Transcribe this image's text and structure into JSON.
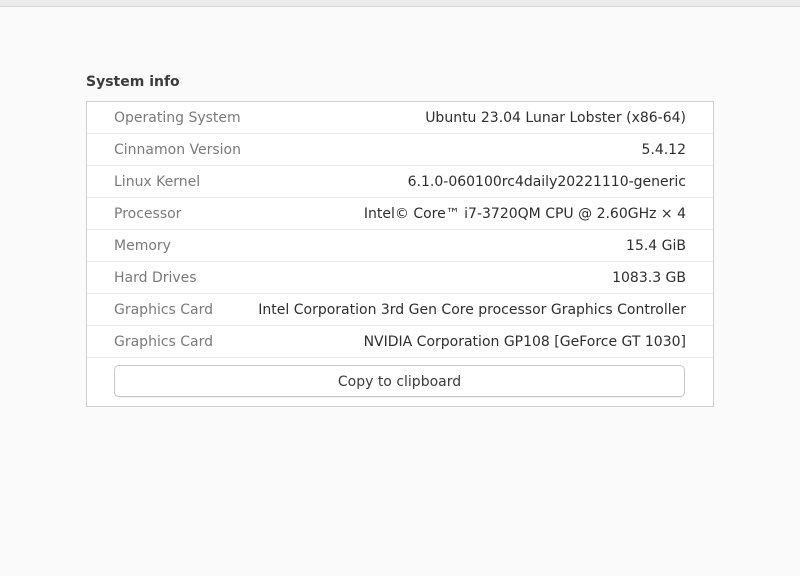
{
  "section": {
    "title": "System info"
  },
  "info_rows": [
    {
      "label": "Operating System",
      "value": "Ubuntu 23.04 Lunar Lobster (x86-64)"
    },
    {
      "label": "Cinnamon Version",
      "value": "5.4.12"
    },
    {
      "label": "Linux Kernel",
      "value": "6.1.0-060100rc4daily20221110-generic"
    },
    {
      "label": "Processor",
      "value": "Intel© Core™ i7-3720QM CPU @ 2.60GHz × 4"
    },
    {
      "label": "Memory",
      "value": "15.4 GiB"
    },
    {
      "label": "Hard Drives",
      "value": "1083.3 GB"
    },
    {
      "label": "Graphics Card",
      "value": "Intel Corporation 3rd Gen Core processor Graphics Controller"
    },
    {
      "label": "Graphics Card",
      "value": "NVIDIA Corporation GP108 [GeForce GT 1030]"
    }
  ],
  "actions": {
    "copy_label": "Copy to clipboard"
  },
  "colors": {
    "background": "#fafafa",
    "panel_border": "#cfcfcf",
    "label_text": "#7a7a7a",
    "value_text": "#2e2e2e"
  }
}
